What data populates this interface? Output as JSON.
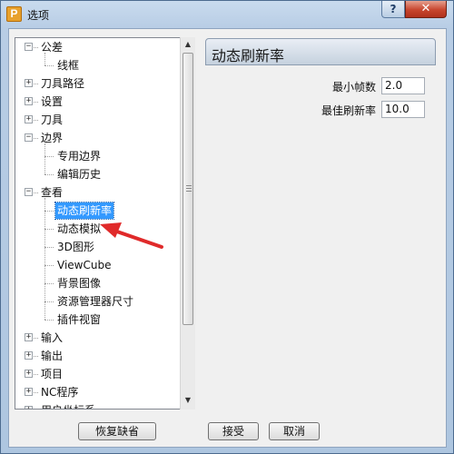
{
  "window": {
    "app_icon_letter": "P",
    "title": "选项",
    "help_label": "?",
    "close_label": "✕"
  },
  "tree": {
    "items": [
      {
        "label": "公差",
        "expander": "⊟"
      },
      {
        "label": "线框"
      },
      {
        "label": "刀具路径",
        "expander": "⊞"
      },
      {
        "label": "设置",
        "expander": "⊞"
      },
      {
        "label": "刀具",
        "expander": "⊞"
      },
      {
        "label": "边界",
        "expander": "⊟"
      },
      {
        "label": "专用边界"
      },
      {
        "label": "编辑历史"
      },
      {
        "label": "查看",
        "expander": "⊟"
      },
      {
        "label": "动态刷新率",
        "selected": true
      },
      {
        "label": "动态模拟"
      },
      {
        "label": "3D图形"
      },
      {
        "label": "ViewCube"
      },
      {
        "label": "背景图像"
      },
      {
        "label": "资源管理器尺寸"
      },
      {
        "label": "插件视窗"
      },
      {
        "label": "输入",
        "expander": "⊞"
      },
      {
        "label": "输出",
        "expander": "⊞"
      },
      {
        "label": "项目",
        "expander": "⊞"
      },
      {
        "label": "NC程序",
        "expander": "⊞"
      },
      {
        "label": "用户坐标系",
        "expander": "⊞"
      }
    ],
    "scroll_up_icon": "▲",
    "scroll_down_icon": "▼"
  },
  "panel": {
    "title": "动态刷新率",
    "fields": [
      {
        "label": "最小帧数",
        "value": "2.0"
      },
      {
        "label": "最佳刷新率",
        "value": "10.0"
      }
    ]
  },
  "buttons": {
    "restore_defaults": "恢复缺省",
    "accept": "接受",
    "cancel": "取消"
  },
  "colors": {
    "selection": "#3399ff",
    "annotation_arrow": "#e02a2a"
  }
}
